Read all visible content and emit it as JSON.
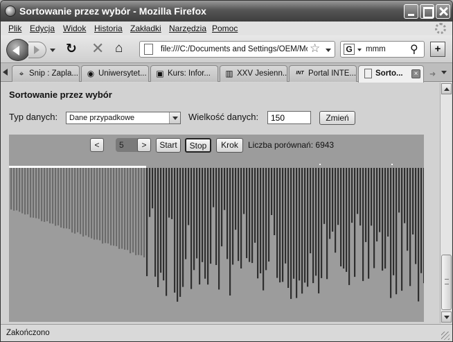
{
  "window": {
    "title": "Sortowanie przez wybór - Mozilla Firefox"
  },
  "menu": [
    "Plik",
    "Edycja",
    "Widok",
    "Historia",
    "Zakładki",
    "Narzędzia",
    "Pomoc"
  ],
  "toolbar": {
    "url": "file:///C:/Documents and Settings/OEM/Moje",
    "search_query": "mmm",
    "search_engine_letter": "G"
  },
  "tabs": [
    {
      "label": "Snip : Zapla...",
      "icon": "target-icon"
    },
    {
      "label": "Uniwersytet...",
      "icon": "logo-icon"
    },
    {
      "label": "Kurs: Infor...",
      "icon": "book-icon"
    },
    {
      "label": "XXV Jesienn...",
      "icon": "ptm-icon"
    },
    {
      "label": "Portal INTE...",
      "icon": "int-icon",
      "icon_text": "INT"
    },
    {
      "label": "Sorto...",
      "icon": "page-icon",
      "active": true
    }
  ],
  "page": {
    "heading": "Sortowanie przez wybór",
    "data_type_label": "Typ danych:",
    "data_type_value": "Dane przypadkowe",
    "size_label": "Wielkość danych:",
    "size_value": "150",
    "change_button": "Zmień",
    "prev_button": "<",
    "speed_value": "5",
    "next_button": ">",
    "start_button": "Start",
    "stop_button": "Stop",
    "step_button": "Krok",
    "comparisons_text": "Liczba porównań: 6943"
  },
  "visualization": {
    "bar_count": 150,
    "sorted_count": 49,
    "colors": {
      "sorted": "#6b6b6b",
      "unsorted": "#2e2e2e",
      "marker": "#ffffff"
    }
  },
  "status": {
    "text": "Zakończono"
  }
}
